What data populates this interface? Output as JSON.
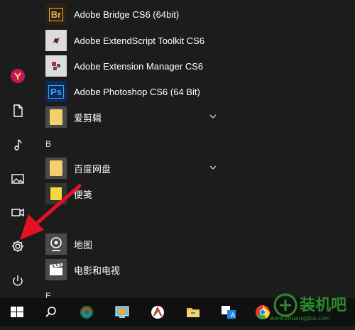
{
  "apps": [
    {
      "id": "bridge",
      "label": "Adobe Bridge CS6 (64bit)",
      "badge": "Br"
    },
    {
      "id": "extendscript",
      "label": "Adobe ExtendScript Toolkit CS6"
    },
    {
      "id": "extension-manager",
      "label": "Adobe Extension Manager CS6"
    },
    {
      "id": "photoshop",
      "label": "Adobe Photoshop CS6 (64 Bit)",
      "badge": "Ps"
    },
    {
      "id": "aijianji",
      "label": "爱剪辑"
    },
    {
      "id": "baidu-netdisk",
      "label": "百度网盘"
    },
    {
      "id": "sticky-notes",
      "label": "便笺"
    },
    {
      "id": "maps",
      "label": "地图"
    },
    {
      "id": "movies-tv",
      "label": "电影和电视"
    }
  ],
  "sections": {
    "b": "B",
    "e": "E"
  },
  "taskbar": {
    "ime_label": "A"
  },
  "watermark": {
    "text": "装机吧",
    "sub": "www.zhuangjiba.com"
  },
  "colors": {
    "accent": "#e81123",
    "tile_bg": "#4a4a4a",
    "folder": "#f3d06b",
    "photoshop": "#2a6fd1",
    "bridge": "#2e2010"
  }
}
